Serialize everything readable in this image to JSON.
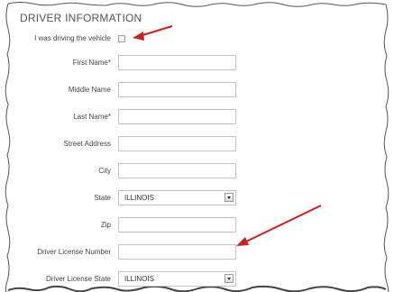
{
  "section": {
    "title": "DRIVER INFORMATION"
  },
  "fields": [
    {
      "label": "I was driving the vehicle",
      "required": false,
      "type": "checkbox",
      "checked": false
    },
    {
      "label": "First Name",
      "required": true,
      "type": "text",
      "value": ""
    },
    {
      "label": "Middle Name",
      "required": false,
      "type": "text",
      "value": ""
    },
    {
      "label": "Last Name",
      "required": true,
      "type": "text",
      "value": ""
    },
    {
      "label": "Street Address",
      "required": false,
      "type": "text",
      "value": ""
    },
    {
      "label": "City",
      "required": false,
      "type": "text",
      "value": ""
    },
    {
      "label": "State",
      "required": false,
      "type": "select",
      "value": "ILLINOIS"
    },
    {
      "label": "Zip",
      "required": false,
      "type": "text",
      "value": ""
    },
    {
      "label": "Driver License Number",
      "required": false,
      "type": "text",
      "value": ""
    },
    {
      "label": "Driver License State",
      "required": false,
      "type": "select",
      "value": "ILLINOIS"
    }
  ],
  "required_marker": "*",
  "colors": {
    "required_marker": "#cc0000",
    "annotation_arrow": "#cc1f1f",
    "field_border": "#c4c4c4",
    "label_text": "#444444"
  },
  "icons": {
    "select_arrow": "chevron-down-icon",
    "annotation": "red-arrow-icon"
  }
}
